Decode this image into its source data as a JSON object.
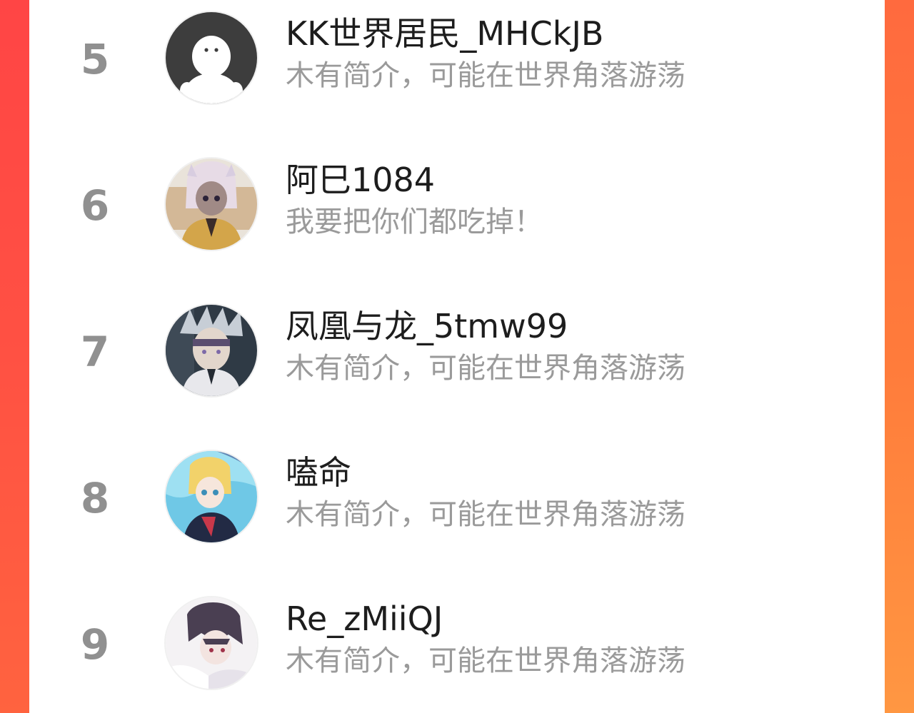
{
  "ranking_list": {
    "items": [
      {
        "rank": "5",
        "name": "KK世界居民_MHCkJB",
        "bio": "木有简介，可能在世界角落游荡",
        "avatar_icon": "default-avatar-icon"
      },
      {
        "rank": "6",
        "name": "阿巳1084",
        "bio": "我要把你们都吃掉！",
        "avatar_icon": "user-avatar-image"
      },
      {
        "rank": "7",
        "name": "凤凰与龙_5tmw99",
        "bio": "木有简介，可能在世界角落游荡",
        "avatar_icon": "user-avatar-image"
      },
      {
        "rank": "8",
        "name": "嗑命",
        "bio": "木有简介，可能在世界角落游荡",
        "avatar_icon": "user-avatar-image"
      },
      {
        "rank": "9",
        "name": "Re_zMiiQJ",
        "bio": "木有简介，可能在世界角落游荡",
        "avatar_icon": "user-avatar-image"
      }
    ]
  },
  "colors": {
    "accent_left": "#ff4545",
    "accent_right": "#ff8a40",
    "rank_text": "#909090",
    "name_text": "#1d1d1d",
    "bio_text": "#9a9a9a"
  }
}
